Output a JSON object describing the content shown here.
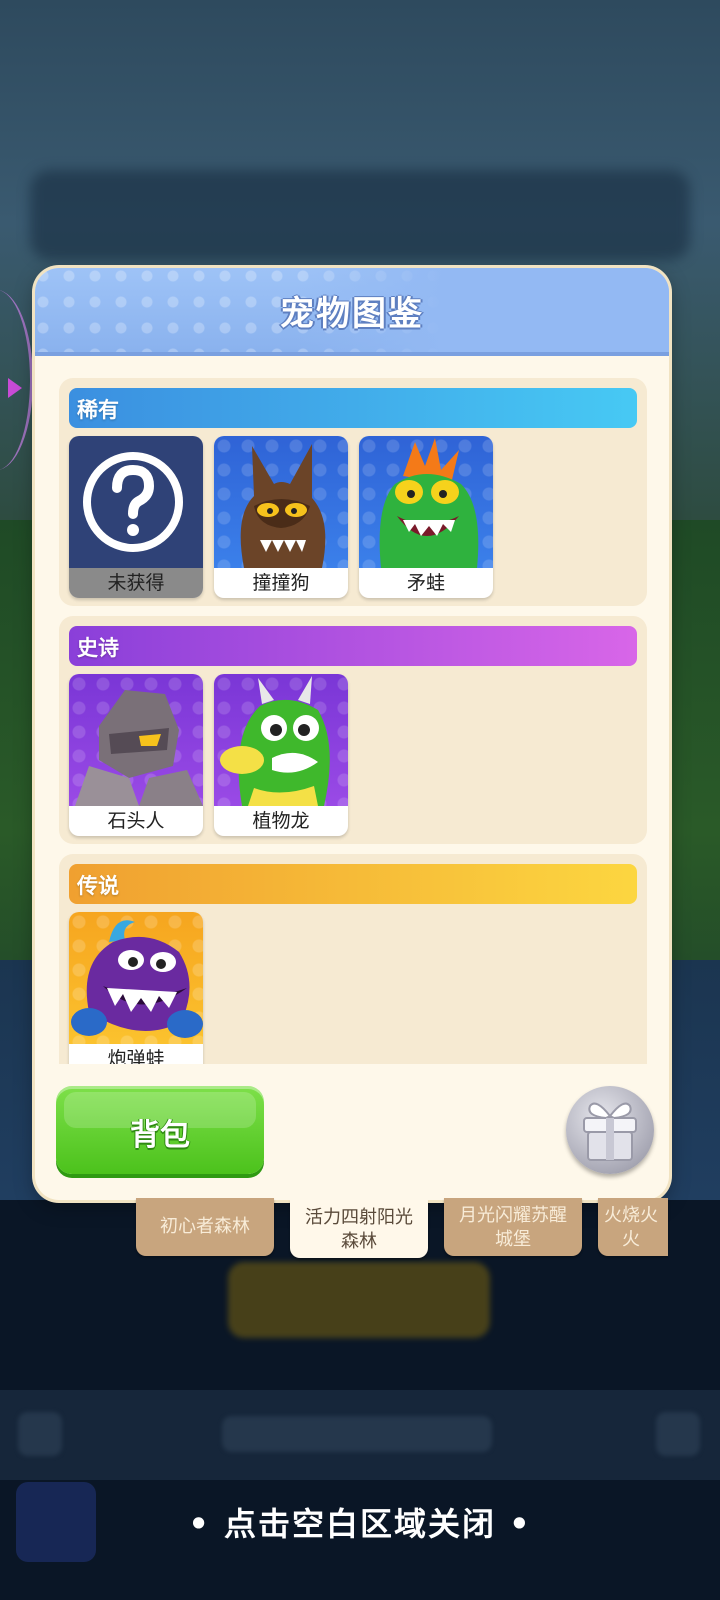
{
  "modal": {
    "title": "宠物图鉴",
    "sections": [
      {
        "label": "稀有",
        "pets": [
          {
            "name": "未获得",
            "icon": "question-mark-icon",
            "locked": true
          },
          {
            "name": "撞撞狗",
            "icon": "brown-bat-pet-icon"
          },
          {
            "name": "矛蛙",
            "icon": "green-frog-pet-icon"
          }
        ]
      },
      {
        "label": "史诗",
        "pets": [
          {
            "name": "石头人",
            "icon": "rock-golem-pet-icon"
          },
          {
            "name": "植物龙",
            "icon": "green-dragon-pet-icon"
          }
        ]
      },
      {
        "label": "传说",
        "pets": [
          {
            "name": "炮弹蛙",
            "icon": "purple-cannon-frog-pet-icon"
          }
        ]
      }
    ],
    "backpack_label": "背包",
    "gift_icon": "gift-box-icon"
  },
  "tabs": [
    {
      "label": "初心者森林"
    },
    {
      "label": "活力四射阳光森林",
      "active": true
    },
    {
      "label": "月光闪耀苏醒城堡"
    },
    {
      "label": "火烧火火"
    }
  ],
  "close_hint": "• 点击空白区域关闭 •",
  "colors": {
    "header": "#8ab2ee",
    "rare": "#3b8fe0",
    "epic": "#8a3fd9",
    "legend": "#f0a030",
    "backpack": "#4cc21c"
  }
}
